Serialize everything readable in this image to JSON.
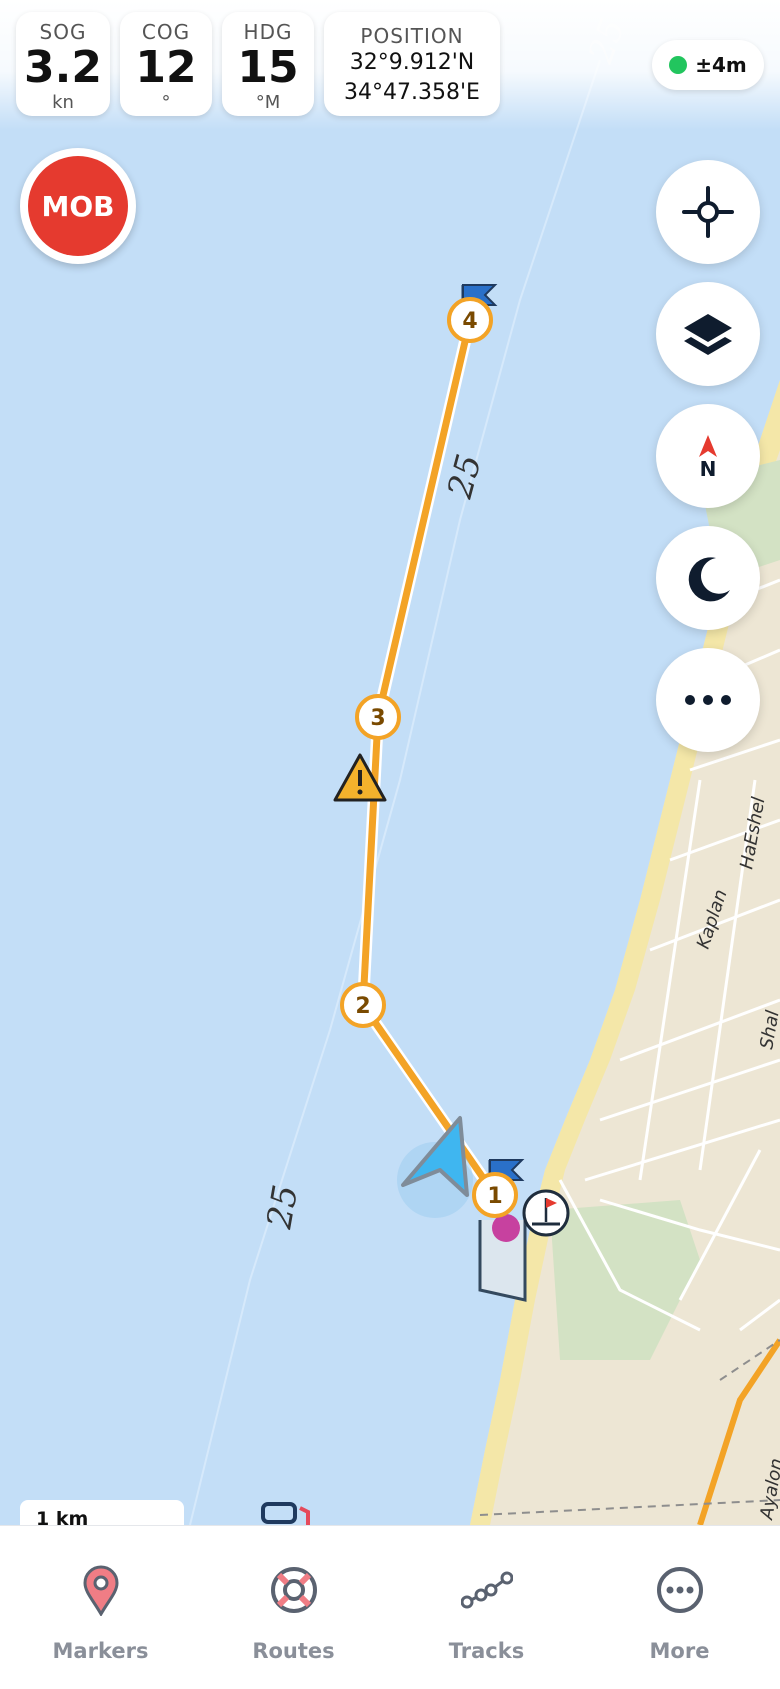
{
  "status_bar": {
    "sog": {
      "label": "SOG",
      "value": "3.2",
      "unit": "kn"
    },
    "cog": {
      "label": "COG",
      "value": "12",
      "unit": "°"
    },
    "hdg": {
      "label": "HDG",
      "value": "15",
      "unit": "°M"
    },
    "position": {
      "label": "POSITION",
      "lat": "32°9.912'N",
      "lon": "34°47.358'E"
    },
    "gps_accuracy": "±4m"
  },
  "mob_button": {
    "label": "MOB"
  },
  "map": {
    "depth_label": "25",
    "streets": [
      "HaEshel",
      "Kaplan",
      "Shal",
      "Ayalon"
    ],
    "route_waypoints": [
      "1",
      "2",
      "3",
      "4"
    ],
    "colors": {
      "water": "#c3def7",
      "land": "#ede6d4",
      "route": "#f3a326",
      "vessel": "#3fb6f0"
    }
  },
  "side_buttons": [
    {
      "icon": "crosshair-icon"
    },
    {
      "icon": "layers-icon"
    },
    {
      "icon": "compass-north-icon",
      "text": "N"
    },
    {
      "icon": "night-mode-moon-icon"
    },
    {
      "icon": "more-options-icon"
    }
  ],
  "scale_bar": {
    "label": "1 km"
  },
  "bottom_nav": [
    {
      "label": "Markers",
      "icon": "map-pin-icon"
    },
    {
      "label": "Routes",
      "icon": "lifebuoy-icon"
    },
    {
      "label": "Tracks",
      "icon": "track-dots-icon"
    },
    {
      "label": "More",
      "icon": "more-circle-icon"
    }
  ]
}
